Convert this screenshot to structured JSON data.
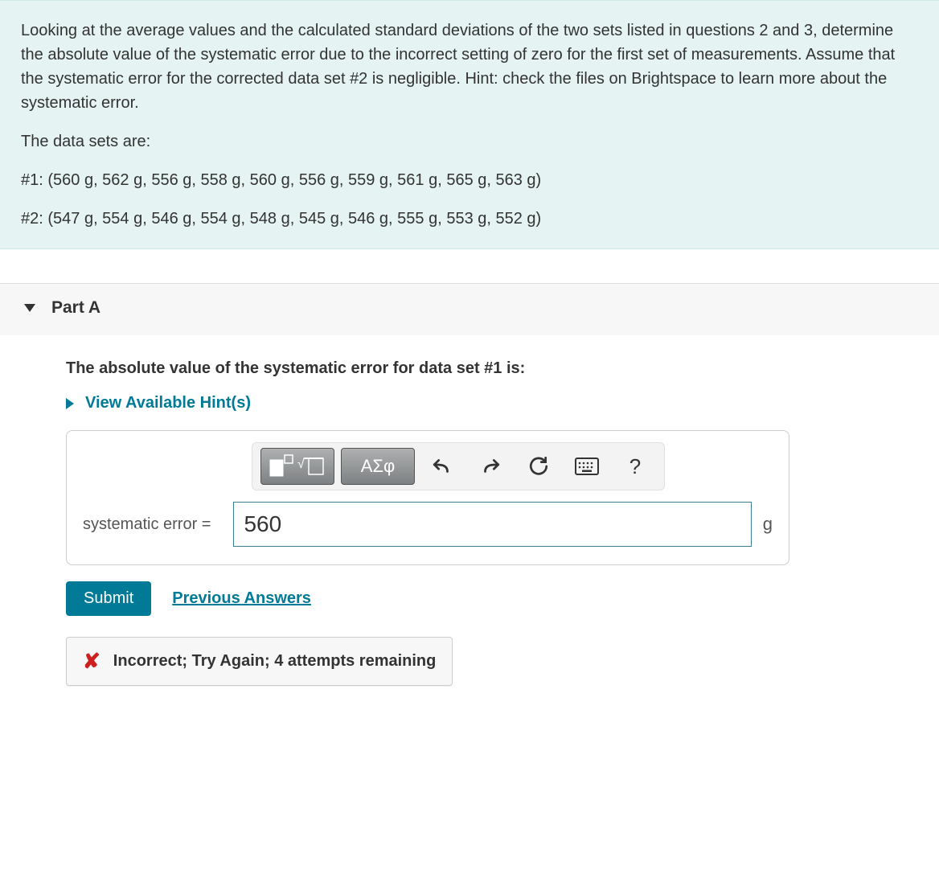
{
  "question": {
    "intro": "Looking at the average values and the calculated standard deviations of the two sets listed in questions 2 and 3, determine the absolute value of the systematic error due to the incorrect setting of zero for the first set of measurements. Assume that the systematic error for the corrected data set #2 is negligible. Hint: check the files on Brightspace to learn more about the systematic error.",
    "data_label": "The data sets are:",
    "set1": "#1: (560 g, 562 g, 556 g, 558 g, 560 g, 556 g, 559 g, 561 g, 565 g, 563 g)",
    "set2": "#2: (547 g, 554 g, 546 g, 554 g, 548 g, 545 g, 546 g, 555 g, 553 g, 552 g)"
  },
  "part": {
    "title": "Part A",
    "prompt": "The absolute value of the systematic error for data set #1 is:",
    "hints_label": "View Available Hint(s)",
    "answer_label": "systematic error =",
    "answer_value": "560",
    "unit": "g",
    "toolbar": {
      "greek": "ΑΣφ",
      "help": "?"
    },
    "submit": "Submit",
    "previous_answers": "Previous Answers",
    "feedback": "Incorrect; Try Again; 4 attempts remaining"
  }
}
